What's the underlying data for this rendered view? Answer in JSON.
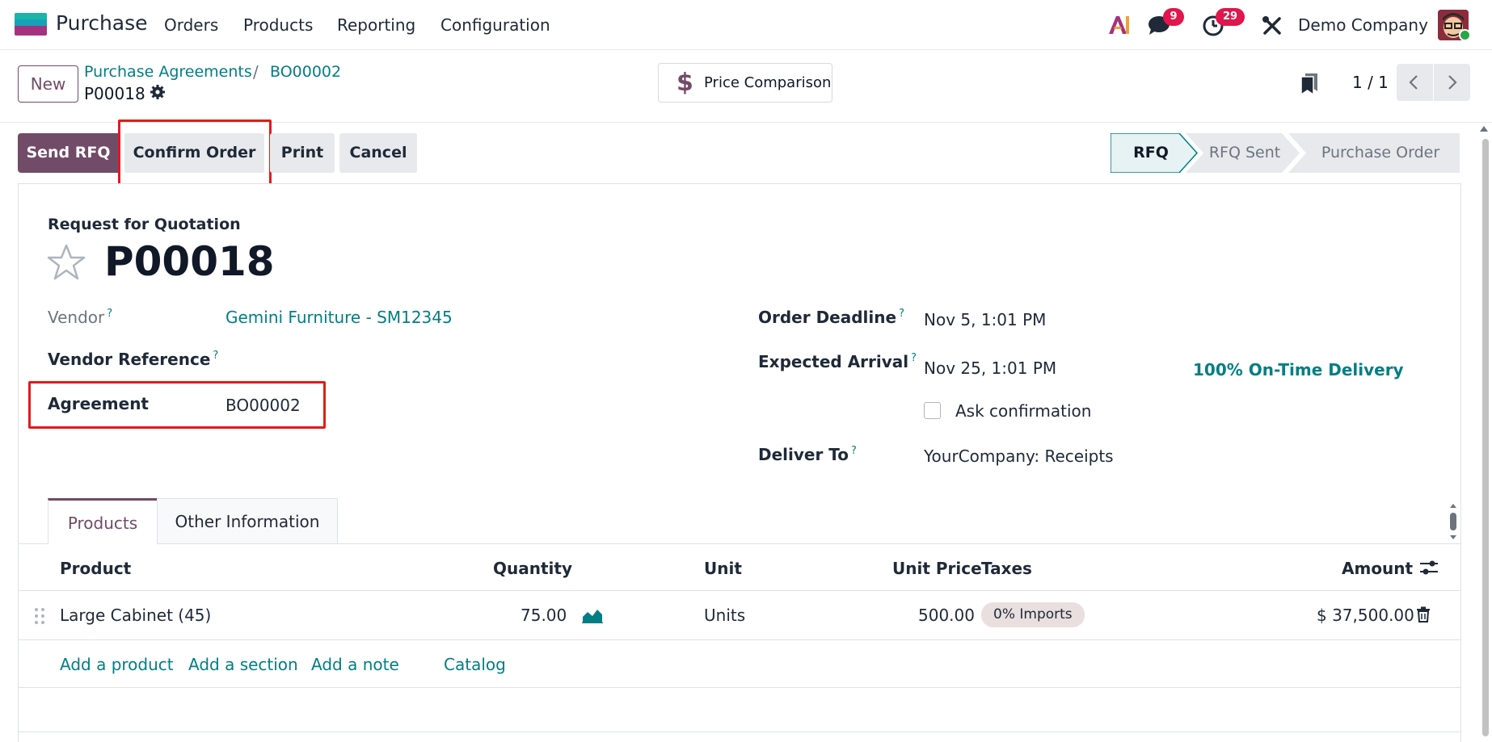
{
  "navbar": {
    "app_name": "Purchase",
    "menu": [
      "Orders",
      "Products",
      "Reporting",
      "Configuration"
    ],
    "messages_count": "9",
    "activities_count": "29",
    "company": "Demo Company"
  },
  "control_panel": {
    "new_label": "New",
    "breadcrumb": [
      "Purchase Agreements",
      "BO00002"
    ],
    "breadcrumb_sep": "/",
    "current_record": "P00018",
    "price_comparison_label": "Price Comparison",
    "pager": "1 / 1"
  },
  "status_bar": {
    "buttons": {
      "send_rfq": "Send RFQ",
      "confirm_order": "Confirm Order",
      "print": "Print",
      "cancel": "Cancel"
    },
    "stages": [
      "RFQ",
      "RFQ Sent",
      "Purchase Order"
    ],
    "active_stage": "RFQ"
  },
  "form": {
    "type_label": "Request for Quotation",
    "name": "P00018",
    "fields": {
      "vendor_label": "Vendor",
      "vendor_value": "Gemini Furniture - SM12345",
      "vendor_ref_label": "Vendor Reference",
      "agreement_label": "Agreement",
      "agreement_value": "BO00002",
      "order_deadline_label": "Order Deadline",
      "order_deadline_value": "Nov 5, 1:01 PM",
      "expected_arrival_label": "Expected Arrival",
      "expected_arrival_value": "Nov 25, 1:01 PM",
      "on_time_delivery": "100% On-Time Delivery",
      "ask_confirmation_label": "Ask confirmation",
      "deliver_to_label": "Deliver To",
      "deliver_to_value": "YourCompany: Receipts"
    },
    "help_mark": "?"
  },
  "notebook": {
    "tabs": [
      "Products",
      "Other Information"
    ],
    "active_tab": "Products"
  },
  "order_lines": {
    "columns": [
      "Product",
      "Quantity",
      "Unit",
      "Unit Price",
      "Taxes",
      "Amount"
    ],
    "rows": [
      {
        "product": "Large Cabinet (45)",
        "quantity": "75.00",
        "unit": "Units",
        "unit_price": "500.00",
        "taxes": "0% Imports",
        "amount": "$ 37,500.00"
      }
    ],
    "add_links": [
      "Add a product",
      "Add a section",
      "Add a note",
      "Catalog"
    ]
  },
  "colors": {
    "primary": "#714b67",
    "link": "#017e84",
    "highlight": "#e21b1b",
    "badge": "#e0164c"
  }
}
